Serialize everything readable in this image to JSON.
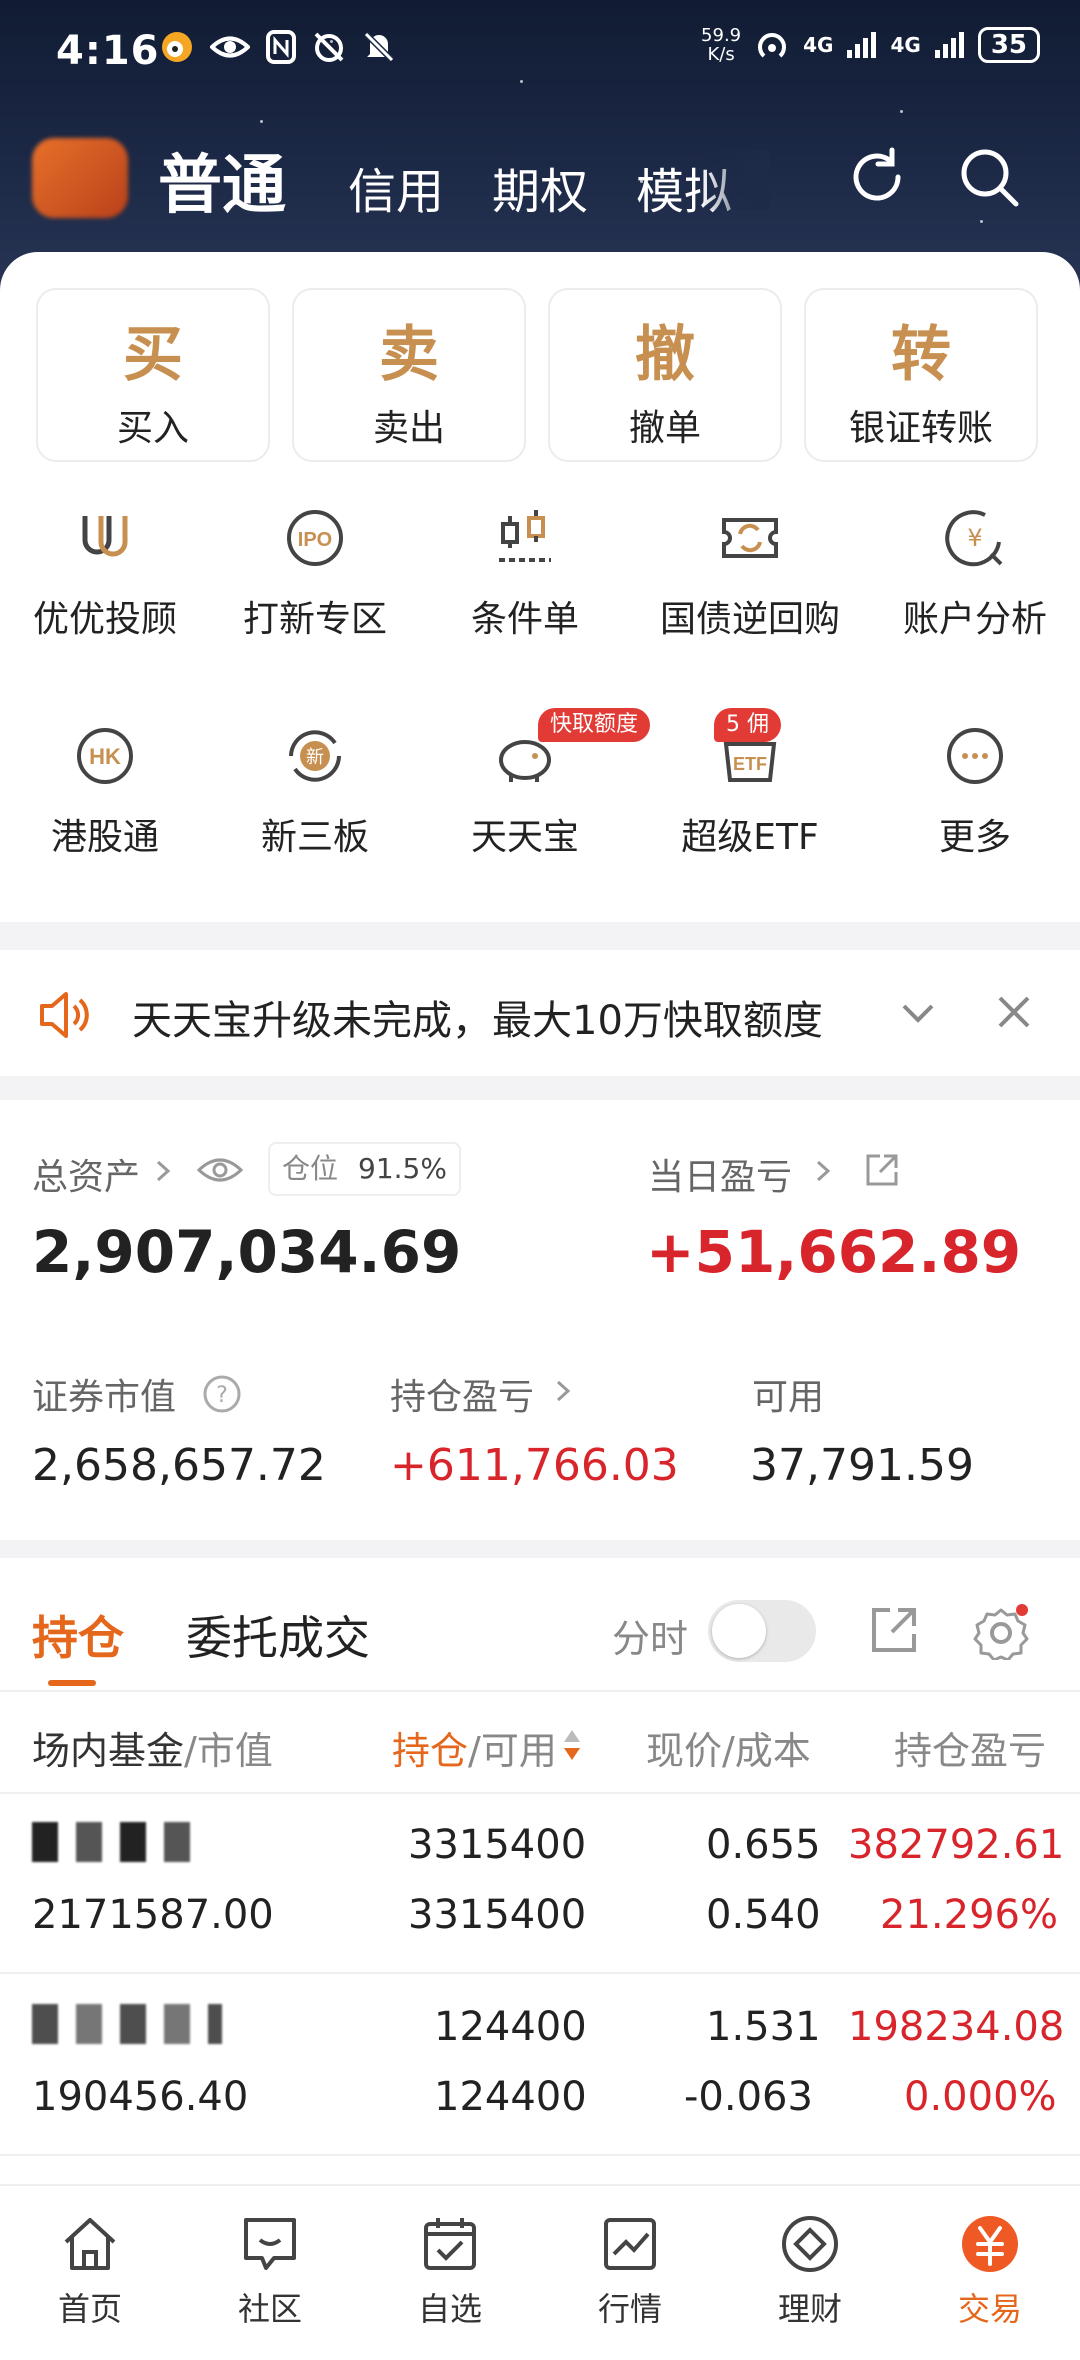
{
  "status_bar": {
    "time": "4:16",
    "speed_value": "59.9",
    "speed_unit": "K/s",
    "net1": "4G",
    "net2": "4G",
    "battery": "35"
  },
  "top_nav": {
    "tabs": [
      "普通",
      "信用",
      "期权",
      "模拟"
    ]
  },
  "quick_actions": [
    {
      "glyph": "买",
      "label": "买入"
    },
    {
      "glyph": "卖",
      "label": "卖出"
    },
    {
      "glyph": "撤",
      "label": "撤单"
    },
    {
      "glyph": "转",
      "label": "银证转账"
    }
  ],
  "feature_grid": [
    {
      "label": "优优投顾",
      "icon": "uu-advisor-icon"
    },
    {
      "label": "打新专区",
      "icon": "ipo-icon"
    },
    {
      "label": "条件单",
      "icon": "condition-order-icon"
    },
    {
      "label": "国债逆回购",
      "icon": "repo-icon"
    },
    {
      "label": "账户分析",
      "icon": "account-analysis-icon"
    },
    {
      "label": "港股通",
      "icon": "hk-connect-icon"
    },
    {
      "label": "新三板",
      "icon": "new-third-board-icon"
    },
    {
      "label": "天天宝",
      "icon": "piggy-bank-icon",
      "badge": "快取额度"
    },
    {
      "label": "超级ETF",
      "icon": "etf-icon",
      "badge": "5    佣"
    },
    {
      "label": "更多",
      "icon": "more-icon"
    }
  ],
  "notice": {
    "text": "天天宝升级未完成，最大10万快取额度"
  },
  "assets": {
    "total_label": "总资产",
    "position_label": "仓位",
    "position_value": "91.5%",
    "total_value": "2,907,034.69",
    "daily_pnl_label": "当日盈亏",
    "daily_pnl_value": "+51,662.89",
    "market_value_label": "证券市值",
    "market_value": "2,658,657.72",
    "holding_pnl_label": "持仓盈亏",
    "holding_pnl_value": "+611,766.03",
    "available_label": "可用",
    "available_value": "37,791.59"
  },
  "positions": {
    "tab_active": "持仓",
    "tab_other": "委托成交",
    "time_share_label": "分时",
    "time_share_on": false,
    "headers": {
      "name": "场内基金",
      "name_sub": "/市值",
      "holding": "持仓",
      "holding_sub": "/可用",
      "price": "现价/成本",
      "pnl": "持仓盈亏"
    },
    "rows": [
      {
        "market_value": "2171587.00",
        "holding": "3315400",
        "available": "3315400",
        "price": "0.655",
        "cost": "0.540",
        "pnl": "382792.61",
        "pnl_pct": "21.296%"
      },
      {
        "market_value": "190456.40",
        "holding": "124400",
        "available": "124400",
        "price": "1.531",
        "cost": "-0.063",
        "pnl": "198234.08",
        "pnl_pct": "0.000%"
      }
    ]
  },
  "bottom_nav": [
    {
      "label": "首页",
      "icon": "home-icon"
    },
    {
      "label": "社区",
      "icon": "community-icon"
    },
    {
      "label": "自选",
      "icon": "watchlist-icon"
    },
    {
      "label": "行情",
      "icon": "market-icon"
    },
    {
      "label": "理财",
      "icon": "wealth-icon"
    },
    {
      "label": "交易",
      "icon": "trade-icon",
      "active": true
    }
  ],
  "colors": {
    "accent": "#e4671c",
    "gold": "#c79051",
    "profit_red": "#d8242b",
    "header_bg": "#1d2a48"
  }
}
